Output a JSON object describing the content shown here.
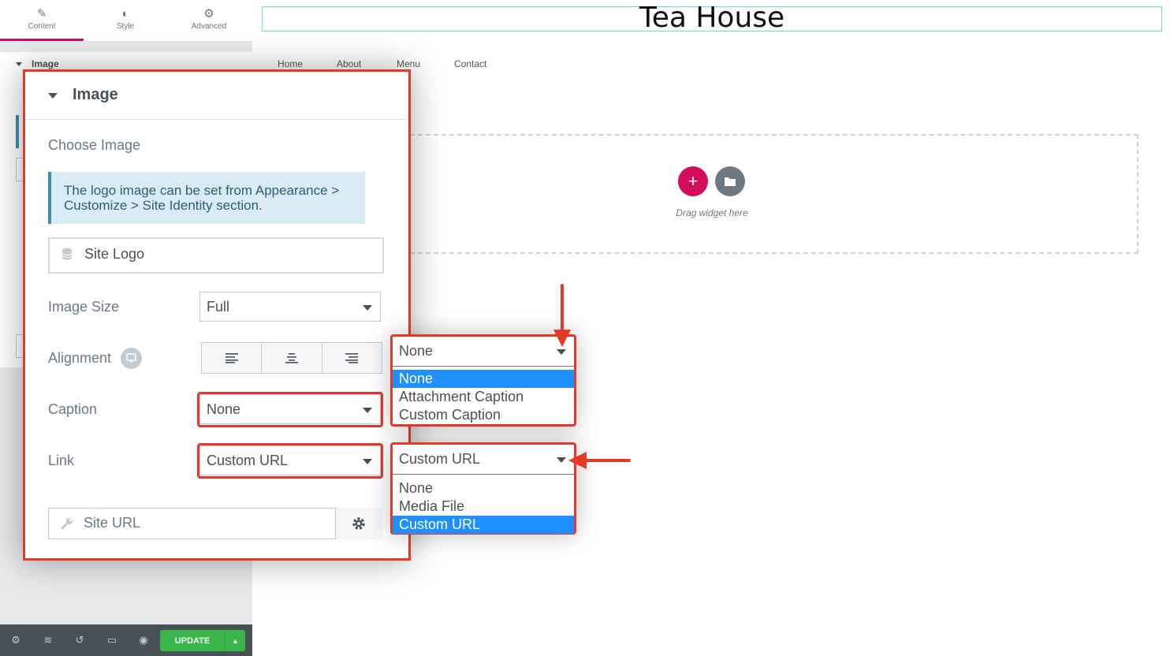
{
  "editor": {
    "tabs": [
      {
        "label": "Content",
        "icon": "pencil-icon"
      },
      {
        "label": "Style",
        "icon": "half-circle-icon"
      },
      {
        "label": "Advanced",
        "icon": "gear-icon"
      }
    ],
    "section_title": "Image",
    "bottom": {
      "update_label": "UPDATE",
      "update_caret": "▲"
    }
  },
  "preview": {
    "site_title": "Tea House",
    "nav": [
      "Home",
      "About",
      "Menu",
      "Contact"
    ],
    "add_label": "+",
    "drag_text": "Drag widget here"
  },
  "panel": {
    "title": "Image",
    "choose_image": "Choose Image",
    "notice": "The logo image can be set from Appearance > Customize > Site Identity section.",
    "site_logo": "Site Logo",
    "image_size": {
      "label": "Image Size",
      "value": "Full"
    },
    "alignment": {
      "label": "Alignment"
    },
    "caption": {
      "label": "Caption",
      "value": "None"
    },
    "link": {
      "label": "Link",
      "value": "Custom URL"
    },
    "site_url": "Site URL"
  },
  "caption_dropdown": {
    "value": "None",
    "options": [
      "None",
      "Attachment Caption",
      "Custom Caption"
    ],
    "selected_index": 0
  },
  "link_dropdown": {
    "value": "Custom URL",
    "options": [
      "None",
      "Media File",
      "Custom URL"
    ],
    "selected_index": 2
  },
  "colors": {
    "accent": "#d30c5c",
    "highlight": "#e33a2a",
    "update_green": "#39b54a",
    "option_selected": "#1e90ff"
  }
}
